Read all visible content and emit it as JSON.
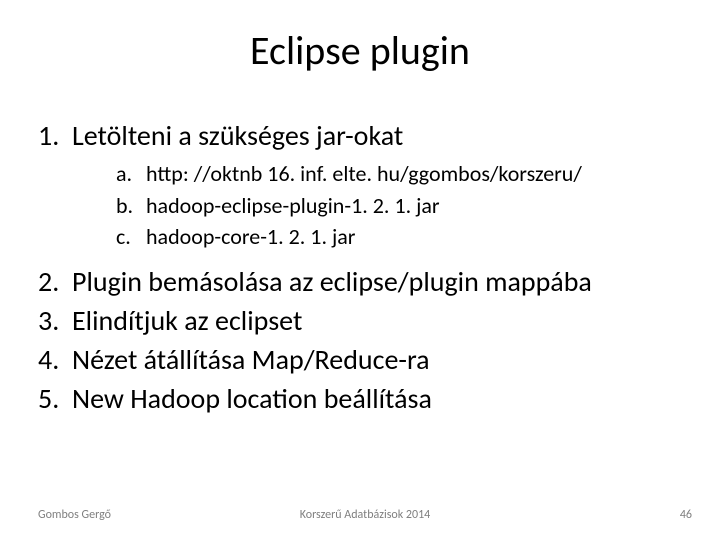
{
  "title": "Eclipse plugin",
  "items": {
    "n1": {
      "num": "1.",
      "text": "Letölteni a szükséges jar-okat"
    },
    "n2": {
      "num": "2.",
      "text": "Plugin bemásolása az eclipse/plugin mappába"
    },
    "n3": {
      "num": "3.",
      "text": "Elindítjuk az eclipset"
    },
    "n4": {
      "num": "4.",
      "text": "Nézet átállítása Map/Reduce-ra"
    },
    "n5": {
      "num": "5.",
      "text": "New Hadoop location beállítása"
    }
  },
  "subitems": {
    "a": {
      "alpha": "a.",
      "text": "http: //oktnb 16. inf. elte. hu/ggombos/korszeru/"
    },
    "b": {
      "alpha": "b.",
      "text": "hadoop-eclipse-plugin-1. 2. 1. jar"
    },
    "c": {
      "alpha": "c.",
      "text": "hadoop-core-1. 2. 1. jar"
    }
  },
  "footer": {
    "left": "Gombos Gergő",
    "center": "Korszerű Adatbázisok 2014",
    "right": "46"
  }
}
